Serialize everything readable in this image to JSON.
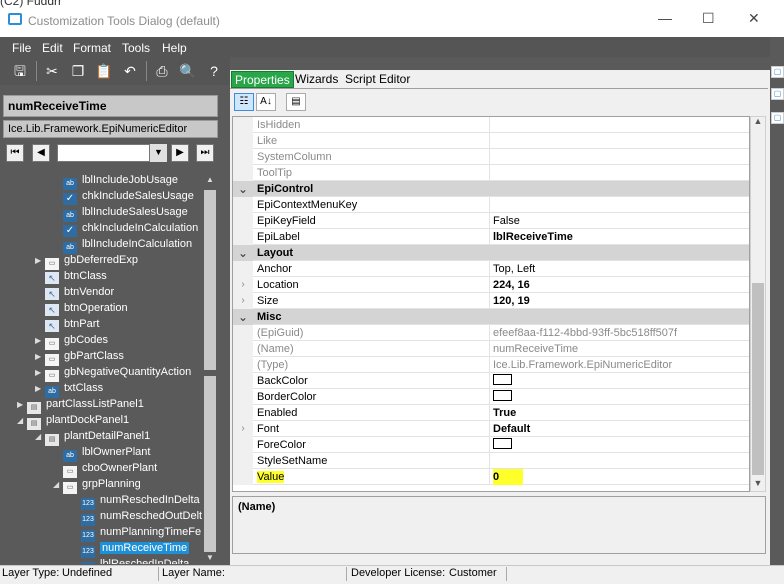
{
  "window": {
    "title": "Customization Tools Dialog (default)",
    "background_text": "(C2)  Fuddrr",
    "minimize": "—",
    "maximize": "☐",
    "close": "✕"
  },
  "menu": [
    "File",
    "Edit",
    "Format",
    "Tools",
    "Help"
  ],
  "toolbar": [
    "save-icon",
    "cut-icon",
    "copy-icon",
    "paste-icon",
    "undo-icon",
    "print-icon",
    "print-preview-icon",
    "help-icon"
  ],
  "left": {
    "control_name": "numReceiveTime",
    "control_type": "Ice.Lib.Framework.EpiNumericEditor",
    "tree": [
      {
        "label": "lblIncludeJobUsage",
        "icon": "ab",
        "indent": 2,
        "exp": ""
      },
      {
        "label": "chkIncludeSalesUsage",
        "icon": "check",
        "indent": 2,
        "exp": ""
      },
      {
        "label": "lblIncludeSalesUsage",
        "icon": "ab",
        "indent": 2,
        "exp": ""
      },
      {
        "label": "chkIncludeInCalculation",
        "icon": "check",
        "indent": 2,
        "exp": ""
      },
      {
        "label": "lblIncludeInCalculation",
        "icon": "ab",
        "indent": 2,
        "exp": ""
      },
      {
        "label": "gbDeferredExp",
        "icon": "folder",
        "indent": 1,
        "exp": "▶"
      },
      {
        "label": "btnClass",
        "icon": "btn",
        "indent": 1,
        "exp": ""
      },
      {
        "label": "btnVendor",
        "icon": "btn",
        "indent": 1,
        "exp": ""
      },
      {
        "label": "btnOperation",
        "icon": "btn",
        "indent": 1,
        "exp": ""
      },
      {
        "label": "btnPart",
        "icon": "btn",
        "indent": 1,
        "exp": ""
      },
      {
        "label": "gbCodes",
        "icon": "folder",
        "indent": 1,
        "exp": "▶"
      },
      {
        "label": "gbPartClass",
        "icon": "folder",
        "indent": 1,
        "exp": "▶"
      },
      {
        "label": "gbNegativeQuantityAction",
        "icon": "folder",
        "indent": 1,
        "exp": "▶"
      },
      {
        "label": "txtClass",
        "icon": "ab",
        "indent": 1,
        "exp": "▶"
      },
      {
        "label": "partClassListPanel1",
        "icon": "panel",
        "indent": 0,
        "exp": "▶"
      },
      {
        "label": "plantDockPanel1",
        "icon": "panel",
        "indent": 0,
        "exp": "◢"
      },
      {
        "label": "plantDetailPanel1",
        "icon": "panel",
        "indent": 1,
        "exp": "◢"
      },
      {
        "label": "lblOwnerPlant",
        "icon": "ab",
        "indent": 2,
        "exp": ""
      },
      {
        "label": "cboOwnerPlant",
        "icon": "folder",
        "indent": 2,
        "exp": ""
      },
      {
        "label": "grpPlanning",
        "icon": "folder",
        "indent": 2,
        "exp": "◢"
      },
      {
        "label": "numReschedInDelta",
        "icon": "123",
        "indent": 3,
        "exp": ""
      },
      {
        "label": "numReschedOutDelt",
        "icon": "123",
        "indent": 3,
        "exp": ""
      },
      {
        "label": "numPlanningTimeFe",
        "icon": "123",
        "indent": 3,
        "exp": ""
      },
      {
        "label": "numReceiveTime",
        "icon": "123",
        "indent": 3,
        "exp": "",
        "selected": true
      },
      {
        "label": "lblReschedInDelta",
        "icon": "ab",
        "indent": 3,
        "exp": ""
      }
    ]
  },
  "tabs": [
    "Properties",
    "Wizards",
    "Script Editor"
  ],
  "grid": {
    "rows": [
      {
        "name": "IsHidden",
        "value": "",
        "style": "dim"
      },
      {
        "name": "Like",
        "value": "",
        "style": "dim"
      },
      {
        "name": "SystemColumn",
        "value": "",
        "style": "dim"
      },
      {
        "name": "ToolTip",
        "value": "",
        "style": "dim"
      },
      {
        "name": "EpiControl",
        "value": "",
        "style": "cat",
        "gutter": "⌄"
      },
      {
        "name": "EpiContextMenuKey",
        "value": "",
        "style": ""
      },
      {
        "name": "EpiKeyField",
        "value": "False",
        "style": ""
      },
      {
        "name": "EpiLabel",
        "value": "lblReceiveTime",
        "style": "bold-val"
      },
      {
        "name": "Layout",
        "value": "",
        "style": "cat",
        "gutter": "⌄"
      },
      {
        "name": "Anchor",
        "value": "Top, Left",
        "style": ""
      },
      {
        "name": "Location",
        "value": "224, 16",
        "style": "bold-val",
        "gutter": "›"
      },
      {
        "name": "Size",
        "value": "120, 19",
        "style": "bold-val",
        "gutter": "›"
      },
      {
        "name": "Misc",
        "value": "",
        "style": "cat",
        "gutter": "⌄"
      },
      {
        "name": "(EpiGuid)",
        "value": "efeef8aa-f112-4bbd-93ff-5bc518ff507f",
        "style": "dim"
      },
      {
        "name": "(Name)",
        "value": "numReceiveTime",
        "style": "dim"
      },
      {
        "name": "(Type)",
        "value": "Ice.Lib.Framework.EpiNumericEditor",
        "style": "dim"
      },
      {
        "name": "BackColor",
        "value": "",
        "style": "",
        "swatch": true
      },
      {
        "name": "BorderColor",
        "value": "",
        "style": "",
        "swatch": true
      },
      {
        "name": "Enabled",
        "value": "True",
        "style": "bold-val"
      },
      {
        "name": "Font",
        "value": "Default",
        "style": "bold-val",
        "gutter": "›"
      },
      {
        "name": "ForeColor",
        "value": "",
        "style": "",
        "swatch": true
      },
      {
        "name": "StyleSetName",
        "value": "",
        "style": ""
      },
      {
        "name": "Value",
        "value": "0",
        "style": "bold-val",
        "highlight": true
      }
    ]
  },
  "description": {
    "title": "(Name)"
  },
  "status": {
    "layer_type_label": "Layer Type:",
    "layer_type_value": "Undefined",
    "layer_name_label": "Layer Name:",
    "layer_name_value": "",
    "license_label": "Developer License:",
    "license_value": "Customer"
  },
  "colors": {
    "active_tab": "#2aa64a",
    "selection": "#1e90d8",
    "highlight": "#ffff2a"
  }
}
